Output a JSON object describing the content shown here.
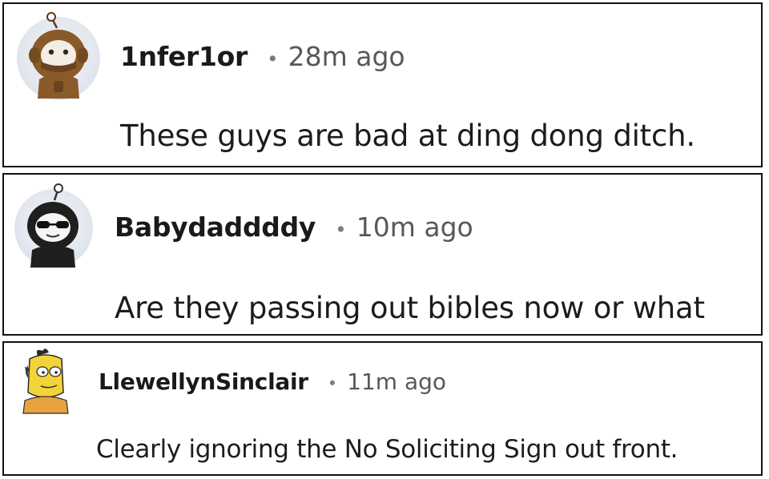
{
  "comments": [
    {
      "username": "1nfer1or",
      "separator": "•",
      "time": "28m ago",
      "text": "These guys are bad at ding dong ditch.",
      "avatar_icon": "snoo-brown-hood-avatar-icon"
    },
    {
      "username": "Babydaddddy",
      "separator": "•",
      "time": "10m ago",
      "text": "Are they passing out bibles now or what",
      "avatar_icon": "snoo-sunglasses-avatar-icon"
    },
    {
      "username": "LlewellynSinclair",
      "separator": "•",
      "time": "11m ago",
      "text": "Clearly ignoring the No Soliciting Sign out front.",
      "avatar_icon": "yellow-cartoon-avatar-icon"
    }
  ],
  "colors": {
    "border": "#111111",
    "username": "#1a1a1b",
    "meta": "#585858",
    "body": "#1c1c1c"
  }
}
